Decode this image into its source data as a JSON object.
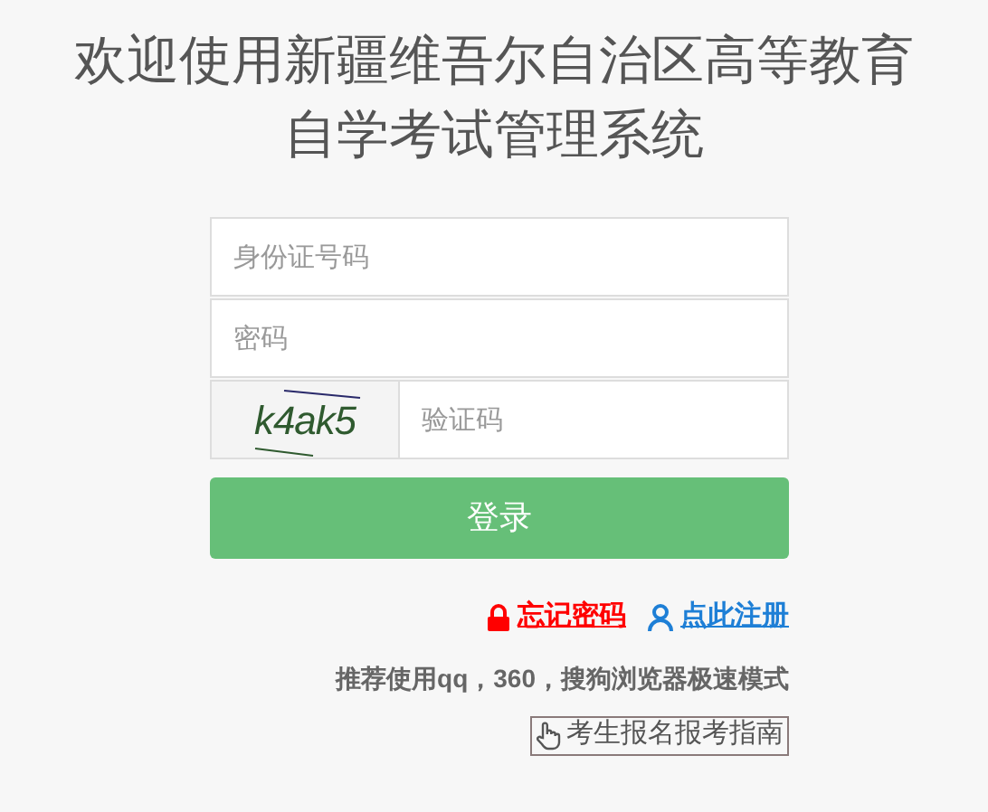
{
  "title": [
    "欢迎使用新疆维吾尔自治区高等教育",
    "自学考试管理系统"
  ],
  "fields": [
    {
      "kind": "text",
      "placeholder": "身份证号码"
    },
    {
      "kind": "password",
      "placeholder": "密码"
    },
    {
      "kind": "captcha",
      "captcha": "k4ak5",
      "placeholder": "验证码"
    }
  ],
  "login_button": "登录",
  "links": [
    {
      "kind": "lock",
      "label": "忘记密码",
      "color": "#ff0000"
    },
    {
      "kind": "user",
      "label": "点此注册",
      "color": "#1e7fd6"
    }
  ],
  "browser_tip": "推荐使用qq，360，搜狗浏览器极速模式",
  "guide_button": "考生报名报考指南"
}
